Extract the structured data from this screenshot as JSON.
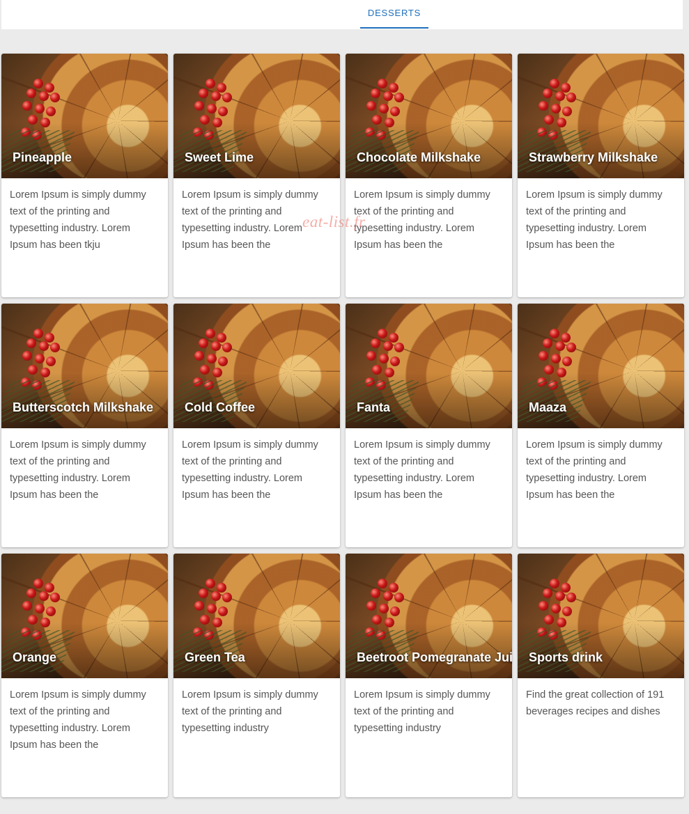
{
  "tabs": {
    "active_label": "DESSERTS"
  },
  "watermark": "eat-list.fr",
  "colors": {
    "accent": "#1e6fbd",
    "background": "#ebebeb",
    "card": "#ffffff"
  },
  "cards": [
    {
      "title": "Pineapple",
      "description": "Lorem Ipsum is simply dummy text of the printing and typesetting industry. Lorem Ipsum has been tkju"
    },
    {
      "title": "Sweet Lime",
      "description": "Lorem Ipsum is simply dummy text of the printing and typesetting industry. Lorem Ipsum has been the"
    },
    {
      "title": "Chocolate Milkshake",
      "description": "Lorem Ipsum is simply dummy text of the printing and typesetting industry. Lorem Ipsum has been the"
    },
    {
      "title": "Strawberry Milkshake",
      "description": "Lorem Ipsum is simply dummy text of the printing and typesetting industry. Lorem Ipsum has been the"
    },
    {
      "title": "Butterscotch Milkshake",
      "description": "Lorem Ipsum is simply dummy text of the printing and typesetting industry. Lorem Ipsum has been the"
    },
    {
      "title": "Cold Coffee",
      "description": "Lorem Ipsum is simply dummy text of the printing and typesetting industry. Lorem Ipsum has been the"
    },
    {
      "title": "Fanta",
      "description": "Lorem Ipsum is simply dummy text of the printing and typesetting industry. Lorem Ipsum has been the"
    },
    {
      "title": "Maaza",
      "description": "Lorem Ipsum is simply dummy text of the printing and typesetting industry. Lorem Ipsum has been the"
    },
    {
      "title": "Orange",
      "description": "Lorem Ipsum is simply dummy text of the printing and typesetting industry. Lorem Ipsum has been the"
    },
    {
      "title": "Green Tea",
      "description": "Lorem Ipsum is simply dummy text of the printing and typesetting industry"
    },
    {
      "title": "Beetroot Pomegranate Juic",
      "description": "Lorem Ipsum is simply dummy text of the printing and typesetting industry"
    },
    {
      "title": "Sports drink",
      "description": "Find the great collection of 191 beverages recipes and dishes"
    }
  ]
}
